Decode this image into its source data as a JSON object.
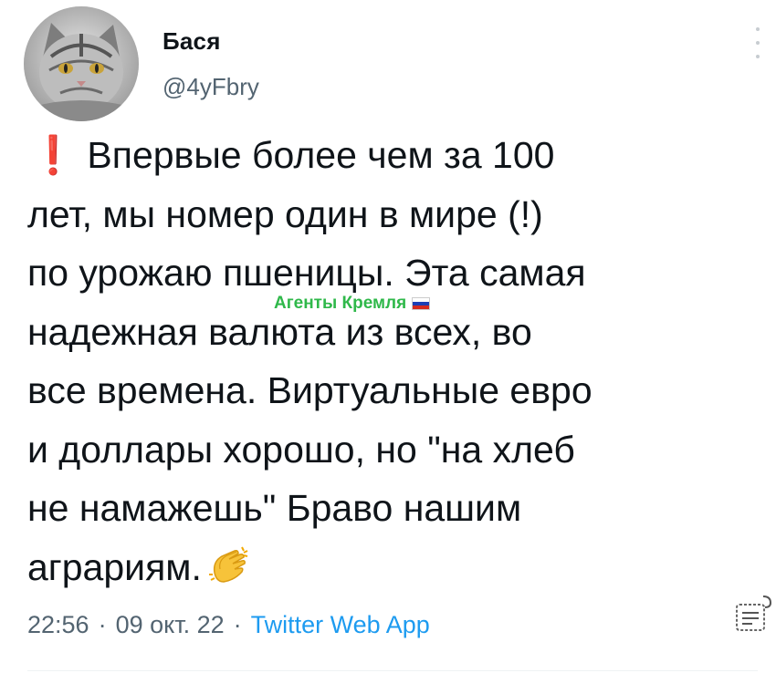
{
  "author": {
    "name": "Бася",
    "handle": "@4yFbry"
  },
  "tweet": {
    "icon": "red-exclamation-emoji",
    "lines": [
      "Впервые более чем за 100",
      "лет, мы номер один в мире (!)",
      "по урожаю пшеницы. Эта самая",
      "надежная валюта из всех, во",
      "все времена. Виртуальные евро",
      "и доллары хорошо, но \"на хлеб",
      "не намажешь\" Браво нашим",
      "аграриям."
    ],
    "exclamation": "❗",
    "trailing_icon": "clapping-hands-emoji"
  },
  "watermark": {
    "text": "Агенты Кремля",
    "icon": "russian-flag-icon",
    "color": "#2fb84a"
  },
  "meta": {
    "time": "22:56",
    "separator": "·",
    "date": "09 окт. 22",
    "source": "Twitter Web App"
  },
  "colors": {
    "text": "#0f1419",
    "secondary": "#536471",
    "link": "#1d9bf0",
    "alert": "#e0242a"
  }
}
